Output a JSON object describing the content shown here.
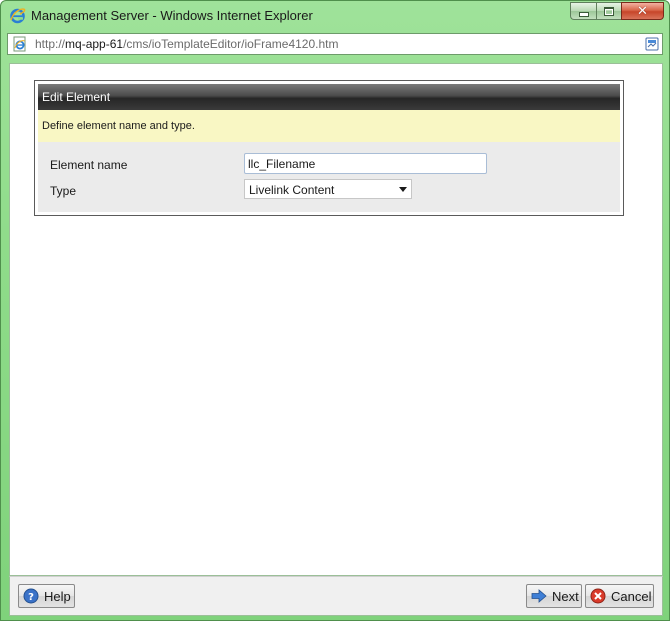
{
  "window": {
    "title": "Management Server - Windows Internet Explorer"
  },
  "address_bar": {
    "url_prefix": "http://",
    "url_host": "mq-app-61",
    "url_path": "/cms/ioTemplateEditor/ioFrame4120.htm"
  },
  "panel": {
    "title": "Edit Element",
    "description": "Define element name and type."
  },
  "form": {
    "element_name_label": "Element name",
    "element_name_value": "llc_Filename",
    "type_label": "Type",
    "type_value": "Livelink Content"
  },
  "footer": {
    "help_label": "Help",
    "next_label": "Next",
    "cancel_label": "Cancel"
  },
  "icons": {
    "app": "ie-logo-icon",
    "page": "ie-page-icon",
    "compat": "compatibility-view-icon",
    "help": "help-icon",
    "next": "next-arrow-icon",
    "cancel": "cancel-icon"
  },
  "colors": {
    "window_frame": "#8fdc8a",
    "panel_header": "#3a3a3a",
    "description_bg": "#f9f7c4",
    "close_button": "#c7462a"
  }
}
